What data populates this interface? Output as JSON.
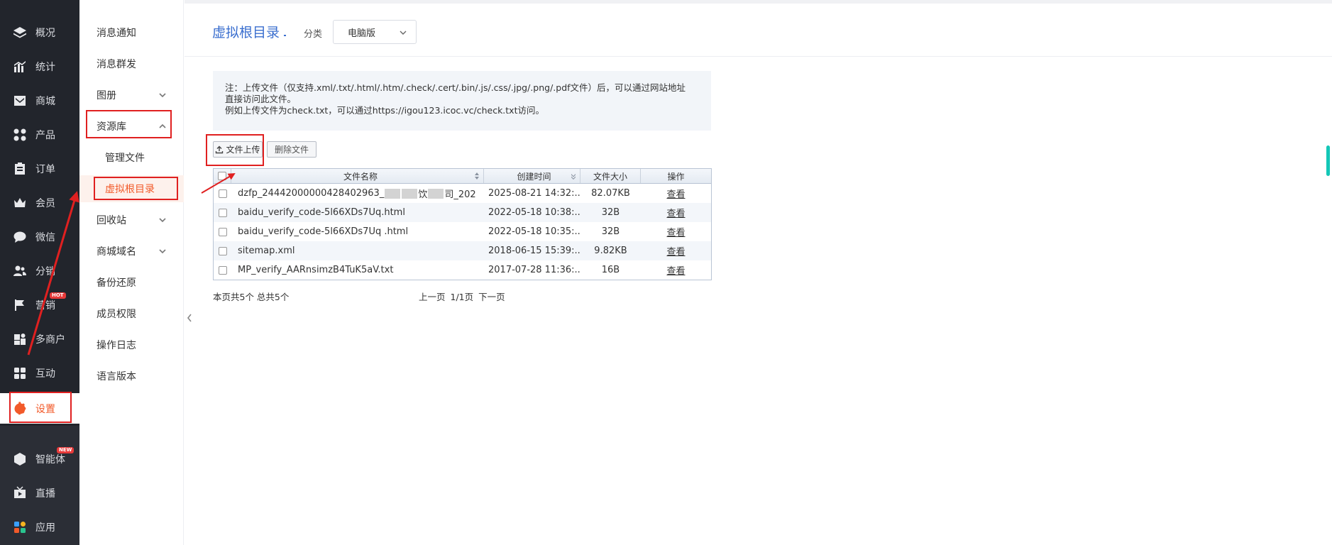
{
  "nav": {
    "items": [
      {
        "label": "概况",
        "icon": "layers-icon"
      },
      {
        "label": "统计",
        "icon": "chart-icon"
      },
      {
        "label": "商城",
        "icon": "mail-icon"
      },
      {
        "label": "产品",
        "icon": "grid-icon"
      },
      {
        "label": "订单",
        "icon": "clipboard-icon"
      },
      {
        "label": "会员",
        "icon": "crown-icon"
      },
      {
        "label": "微信",
        "icon": "chat-icon"
      },
      {
        "label": "分销",
        "icon": "users-icon"
      },
      {
        "label": "营销",
        "icon": "flag-icon",
        "badge": "HOT"
      },
      {
        "label": "多商户",
        "icon": "store-icon"
      },
      {
        "label": "互动",
        "icon": "apps-icon"
      },
      {
        "label": "设置",
        "icon": "gear-icon",
        "active": true
      }
    ],
    "bottom_items": [
      {
        "label": "智能体",
        "icon": "cube-icon",
        "badge": "NEW"
      },
      {
        "label": "直播",
        "icon": "tv-icon"
      },
      {
        "label": "应用",
        "icon": "apps-color-icon"
      }
    ]
  },
  "subnav": {
    "items": [
      {
        "label": "消息通知",
        "expandable": false
      },
      {
        "label": "消息群发",
        "expandable": false
      },
      {
        "label": "图册",
        "expandable": true,
        "expanded": false
      },
      {
        "label": "资源库",
        "expandable": true,
        "expanded": true
      },
      {
        "label": "管理文件",
        "child": true
      },
      {
        "label": "虚拟根目录",
        "child": true,
        "current": true
      },
      {
        "label": "回收站",
        "expandable": true,
        "expanded": false
      },
      {
        "label": "商城域名",
        "expandable": true,
        "expanded": false
      },
      {
        "label": "备份还原",
        "expandable": false
      },
      {
        "label": "成员权限",
        "expandable": false
      },
      {
        "label": "操作日志",
        "expandable": false
      },
      {
        "label": "语言版本",
        "expandable": false
      }
    ]
  },
  "header": {
    "title": "虚拟根目录",
    "category_label": "分类",
    "category_value": "电脑版"
  },
  "notice": {
    "line1": "注：上传文件（仅支持.xml/.txt/.html/.htm/.check/.cert/.bin/.js/.css/.jpg/.png/.pdf文件）后，可以通过网站地址",
    "line2": "直接访问此文件。",
    "line3": "例如上传文件为check.txt，可以通过https://igou123.icoc.vc/check.txt访问。"
  },
  "toolbar": {
    "upload_label": "文件上传",
    "delete_label": "删除文件"
  },
  "table": {
    "headers": {
      "name": "文件名称",
      "created": "创建时间",
      "size": "文件大小",
      "action": "操作"
    },
    "rows": [
      {
        "name_prefix": "dzfp_24442000000428402963_",
        "name_mid": "饮",
        "name_suffix": "司_202",
        "created": "2025-08-21 14:32:...",
        "size": "82.07KB",
        "action": "查看"
      },
      {
        "name": "baidu_verify_code-5l66XDs7Uq.html",
        "created": "2022-05-18 10:38:...",
        "size": "32B",
        "action": "查看"
      },
      {
        "name": "baidu_verify_code-5l66XDs7Uq .html",
        "created": "2022-05-18 10:35:...",
        "size": "32B",
        "action": "查看"
      },
      {
        "name": "sitemap.xml",
        "created": "2018-06-15 15:39:...",
        "size": "9.82KB",
        "action": "查看"
      },
      {
        "name": "MP_verify_AARnsimzB4TuK5aV.txt",
        "created": "2017-07-28 11:36:...",
        "size": "16B",
        "action": "查看"
      }
    ]
  },
  "pagination": {
    "info": "本页共5个 总共5个",
    "prev": "上一页",
    "page": "1/1页",
    "next": "下一页"
  },
  "colors": {
    "accent": "#f25a2a",
    "title_blue": "#3b6fcf",
    "annotation_red": "#e02020",
    "scroll_teal": "#14c7b7"
  }
}
